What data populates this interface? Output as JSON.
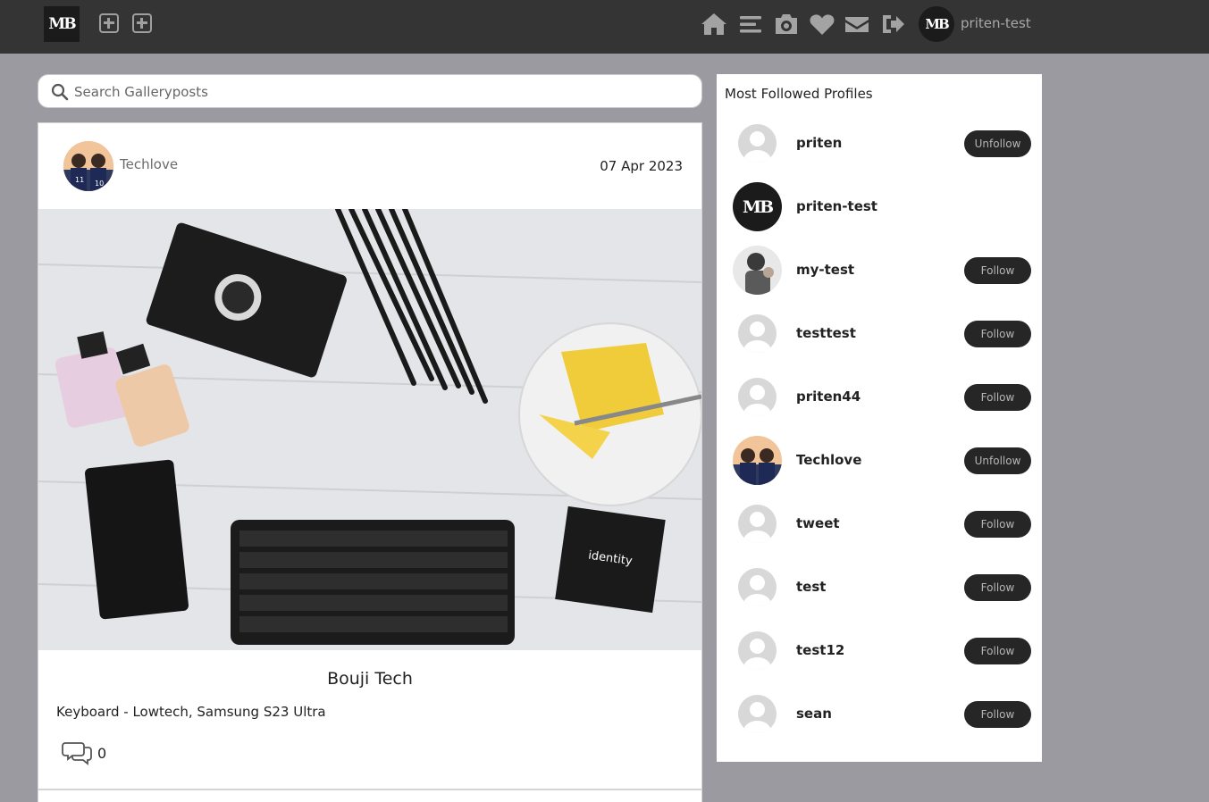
{
  "navbar": {
    "logo_text": "MB",
    "icons": [
      "add-post-icon",
      "add-gallery-icon",
      "home-icon",
      "menu-icon",
      "camera-icon",
      "heart-icon",
      "envelope-icon",
      "logout-icon"
    ],
    "avatar_text": "MB",
    "username": "priten-test"
  },
  "search": {
    "placeholder": "Search Galleryposts",
    "value": ""
  },
  "post": {
    "author": "Techlove",
    "date": "07 Apr 2023",
    "title": "Bouji Tech",
    "description": "Keyboard - Lowtech, Samsung S23 Ultra",
    "comment_count": "0"
  },
  "sidebar": {
    "title": "Most Followed Profiles",
    "profiles": [
      {
        "name": "priten",
        "button": "Unfollow",
        "avatar": "default"
      },
      {
        "name": "priten-test",
        "button": "",
        "avatar": "mb",
        "avatar_text": "MB"
      },
      {
        "name": "my-test",
        "button": "Follow",
        "avatar": "photo"
      },
      {
        "name": "testtest",
        "button": "Follow",
        "avatar": "default"
      },
      {
        "name": "priten44",
        "button": "Follow",
        "avatar": "default"
      },
      {
        "name": "Techlove",
        "button": "Unfollow",
        "avatar": "photo"
      },
      {
        "name": "tweet",
        "button": "Follow",
        "avatar": "default"
      },
      {
        "name": "test",
        "button": "Follow",
        "avatar": "default"
      },
      {
        "name": "test12",
        "button": "Follow",
        "avatar": "default"
      },
      {
        "name": "sean",
        "button": "Follow",
        "avatar": "default"
      }
    ]
  },
  "colors": {
    "navbar": "#343434",
    "page_bg": "#9b9aa0",
    "button_bg": "#262626"
  }
}
